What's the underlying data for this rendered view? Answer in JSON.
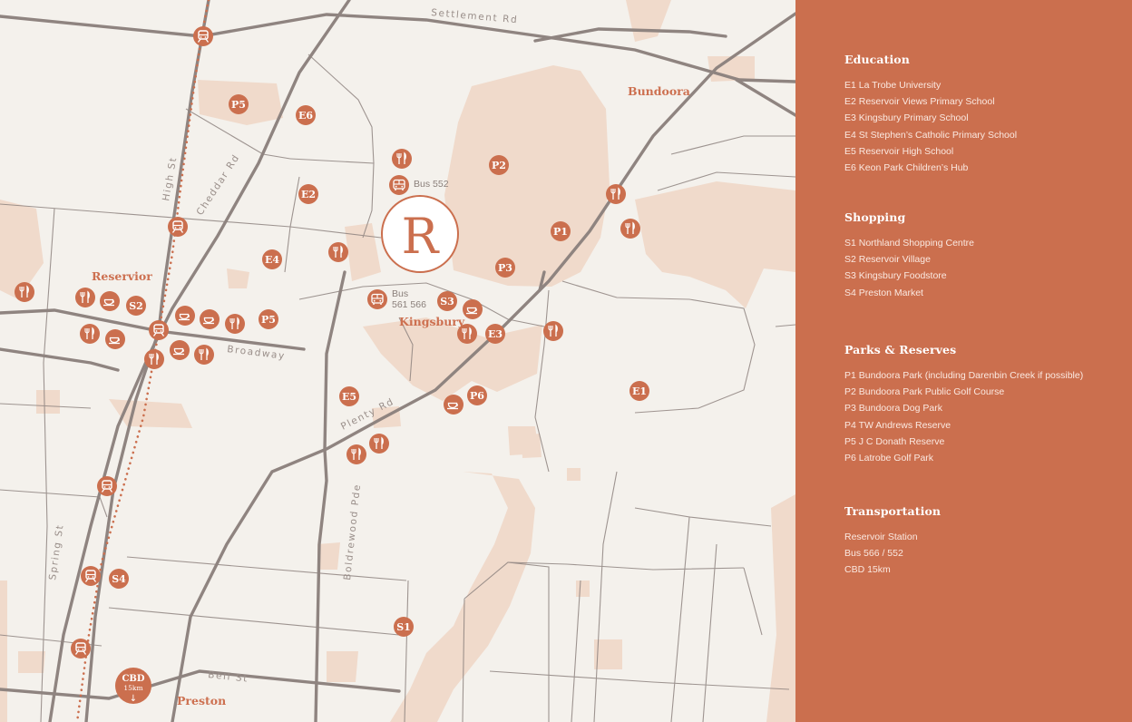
{
  "colors": {
    "background": "#f4f1ec",
    "park": "#f0dacb",
    "road": "#8f8480",
    "accent": "#cb6f4e",
    "panel_text": "#fbe9e1"
  },
  "map": {
    "roads": {
      "settlement": "Settlement Rd",
      "high": "High St",
      "cheddar": "Cheddar Rd",
      "broadway": "Broadway",
      "plenty": "Plenty Rd",
      "boldrewood": "Boldrewood Pde",
      "spring": "Spring St",
      "bell": "Bell St"
    },
    "suburbs": {
      "bundoora": "Bundoora",
      "reservior": "Reservior",
      "kingsbury": "Kingsbury",
      "preston": "Preston"
    },
    "bus_labels": {
      "bus552": "Bus 552",
      "bus561_line1": "Bus",
      "bus561_line2": "561 566"
    },
    "logo": "R",
    "cbd": {
      "line1": "CBD",
      "line2": "15km",
      "arrow": "↓"
    },
    "markers": {
      "P5a": "P5",
      "P5b": "P5",
      "E6": "E6",
      "E2": "E2",
      "E4": "E4",
      "P2": "P2",
      "P1": "P1",
      "P3": "P3",
      "S2": "S2",
      "S3": "S3",
      "E3": "E3",
      "E5": "E5",
      "P6": "P6",
      "E1": "E1",
      "S4": "S4",
      "S1": "S1"
    },
    "icon_names": {
      "train": "train-station-icon",
      "cafe": "cafe-icon",
      "restaurant": "restaurant-icon",
      "bus": "bus-icon"
    }
  },
  "legend": {
    "sections": [
      {
        "title": "Education",
        "items": [
          "E1 La Trobe University",
          "E2 Reservoir Views Primary School",
          "E3 Kingsbury Primary School",
          "E4 St Stephen’s Catholic Primary School",
          "E5 Reservoir High School",
          "E6 Keon Park Children’s Hub"
        ]
      },
      {
        "title": "Shopping",
        "items": [
          "S1 Northland Shopping Centre",
          "S2 Reservoir Village",
          "S3 Kingsbury Foodstore",
          "S4 Preston Market"
        ]
      },
      {
        "title": "Parks & Reserves",
        "items": [
          "P1 Bundoora Park (including Darenbin Creek if possible)",
          "P2 Bundoora Park Public Golf Course",
          "P3 Bundoora Dog Park",
          "P4 TW Andrews Reserve",
          "P5 J C Donath Reserve",
          "P6 Latrobe Golf Park"
        ]
      },
      {
        "title": "Transportation",
        "items": [
          "Reservoir Station",
          "Bus 566 / 552",
          "CBD 15km"
        ]
      }
    ]
  }
}
